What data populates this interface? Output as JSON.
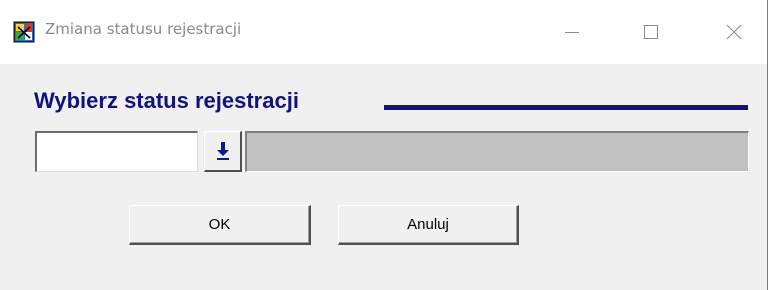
{
  "window": {
    "title": "Zmiana statusu rejestracji",
    "icons": {
      "app": "app-icon",
      "minimize": "minimize-icon",
      "maximize": "maximize-icon",
      "close": "close-icon"
    }
  },
  "dialog": {
    "heading": "Wybierz status rejestracji",
    "status_code": {
      "value": "",
      "placeholder": ""
    },
    "dropdown_icon": "arrow-down-icon",
    "status_description": "",
    "ok_label": "OK",
    "cancel_label": "Anuluj"
  },
  "colors": {
    "heading": "#12127e",
    "face": "#f0f0f0",
    "disabled_field": "#c0c0c0",
    "dropdown_arrow": "#0a1a8c"
  }
}
